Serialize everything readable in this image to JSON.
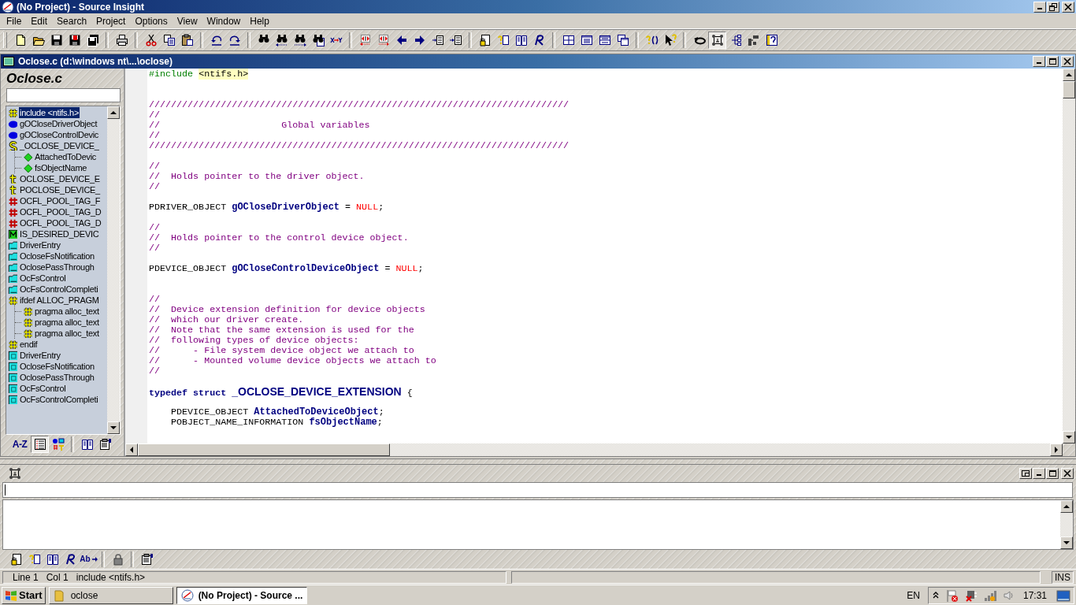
{
  "window": {
    "title": "(No Project) - Source Insight"
  },
  "menu": [
    "File",
    "Edit",
    "Search",
    "Project",
    "Options",
    "View",
    "Window",
    "Help"
  ],
  "toolbar": [
    [
      {
        "kind": "new",
        "pressed": false
      },
      {
        "kind": "open",
        "pressed": false
      },
      {
        "kind": "save",
        "pressed": false
      },
      {
        "kind": "saveas",
        "pressed": false
      },
      {
        "kind": "saveall",
        "pressed": false
      }
    ],
    [
      {
        "kind": "print",
        "pressed": false
      }
    ],
    [
      {
        "kind": "cut",
        "pressed": false
      },
      {
        "kind": "copy",
        "pressed": false
      },
      {
        "kind": "paste",
        "pressed": false
      }
    ],
    [
      {
        "kind": "undo",
        "pressed": false
      },
      {
        "kind": "redo",
        "pressed": false
      }
    ],
    [
      {
        "kind": "find",
        "pressed": false
      },
      {
        "kind": "findprev",
        "pressed": false
      },
      {
        "kind": "findnext",
        "pressed": false
      },
      {
        "kind": "findfiles",
        "pressed": false
      },
      {
        "kind": "replace",
        "pressed": false
      }
    ],
    [
      {
        "kind": "jumpback",
        "pressed": false
      },
      {
        "kind": "jumpfwd",
        "pressed": false
      },
      {
        "kind": "back",
        "pressed": false
      },
      {
        "kind": "forward",
        "pressed": false
      },
      {
        "kind": "outdent",
        "pressed": false
      },
      {
        "kind": "indent",
        "pressed": false
      }
    ],
    [
      {
        "kind": "lookup",
        "pressed": false
      },
      {
        "kind": "symbolinfo",
        "pressed": false
      },
      {
        "kind": "book",
        "pressed": false
      },
      {
        "kind": "reference",
        "pressed": false
      }
    ],
    [
      {
        "kind": "tile",
        "pressed": false
      },
      {
        "kind": "window",
        "pressed": false
      },
      {
        "kind": "split",
        "pressed": false
      },
      {
        "kind": "cascade",
        "pressed": false
      }
    ],
    [
      {
        "kind": "funcinfo",
        "pressed": false
      },
      {
        "kind": "pointerhelp",
        "pressed": false
      }
    ],
    [
      {
        "kind": "loop",
        "pressed": false
      },
      {
        "kind": "browse",
        "pressed": true
      },
      {
        "kind": "tree",
        "pressed": false
      },
      {
        "kind": "relation",
        "pressed": false
      },
      {
        "kind": "help",
        "pressed": false
      }
    ]
  ],
  "document": {
    "title": "Oclose.c (d:\\windows nt\\...\\oclose)",
    "symbol_panel": {
      "title": "Oclose.c",
      "items": [
        {
          "kind": "include",
          "label": "include <ntifs.h>",
          "selected": true
        },
        {
          "kind": "variable",
          "label": "gOCloseDriverObject",
          "selected": false
        },
        {
          "kind": "variable",
          "label": "gOCloseControlDevic",
          "selected": false
        },
        {
          "kind": "struct",
          "label": "_OCLOSE_DEVICE_",
          "selected": false,
          "children": [
            {
              "kind": "member",
              "label": "AttachedToDevic",
              "selected": false
            },
            {
              "kind": "member",
              "label": "fsObjectName",
              "selected": false
            }
          ]
        },
        {
          "kind": "typedef",
          "label": "OCLOSE_DEVICE_E",
          "selected": false
        },
        {
          "kind": "typedef",
          "label": "POCLOSE_DEVICE_",
          "selected": false
        },
        {
          "kind": "define",
          "label": "OCFL_POOL_TAG_F",
          "selected": false
        },
        {
          "kind": "define",
          "label": "OCFL_POOL_TAG_D",
          "selected": false
        },
        {
          "kind": "define",
          "label": "OCFL_POOL_TAG_D",
          "selected": false
        },
        {
          "kind": "macro",
          "label": "IS_DESIRED_DEVIC",
          "selected": false
        },
        {
          "kind": "prototype",
          "label": "DriverEntry",
          "selected": false
        },
        {
          "kind": "prototype",
          "label": "OcloseFsNotification",
          "selected": false
        },
        {
          "kind": "prototype",
          "label": "OclosePassThrough",
          "selected": false
        },
        {
          "kind": "prototype",
          "label": "OcFsControl",
          "selected": false
        },
        {
          "kind": "prototype",
          "label": "OcFsControlCompleti",
          "selected": false
        },
        {
          "kind": "include",
          "label": "ifdef ALLOC_PRAGM",
          "selected": false,
          "children": [
            {
              "kind": "include",
              "label": "pragma alloc_text",
              "selected": false
            },
            {
              "kind": "include",
              "label": "pragma alloc_text",
              "selected": false
            },
            {
              "kind": "include",
              "label": "pragma alloc_text",
              "selected": false
            }
          ]
        },
        {
          "kind": "include",
          "label": "endif",
          "selected": false
        },
        {
          "kind": "function",
          "label": "DriverEntry",
          "selected": false
        },
        {
          "kind": "function",
          "label": "OcloseFsNotification",
          "selected": false
        },
        {
          "kind": "function",
          "label": "OclosePassThrough",
          "selected": false
        },
        {
          "kind": "function",
          "label": "OcFsControl",
          "selected": false
        },
        {
          "kind": "function",
          "label": "OcFsControlCompleti",
          "selected": false
        }
      ],
      "toolbar": [
        {
          "kind": "sort",
          "label": "A-Z",
          "pressed": false
        },
        {
          "kind": "list",
          "pressed": true
        },
        {
          "kind": "categories",
          "pressed": false
        },
        {
          "kind": "book",
          "pressed": false
        },
        {
          "kind": "properties",
          "pressed": false
        }
      ]
    },
    "code": [
      {
        "kind": "code",
        "tokens": [
          {
            "kind": "preproc",
            "text": "#include "
          },
          {
            "kind": "header",
            "text": "<ntifs.h>"
          }
        ]
      },
      {
        "kind": "blank"
      },
      {
        "kind": "blank"
      },
      {
        "kind": "code",
        "tokens": [
          {
            "kind": "comment",
            "text": "////////////////////////////////////////////////////////////////////////////"
          }
        ]
      },
      {
        "kind": "code",
        "tokens": [
          {
            "kind": "comment",
            "text": "//"
          }
        ]
      },
      {
        "kind": "code",
        "tokens": [
          {
            "kind": "comment",
            "text": "//                      Global variables"
          }
        ]
      },
      {
        "kind": "code",
        "tokens": [
          {
            "kind": "comment",
            "text": "//"
          }
        ]
      },
      {
        "kind": "code",
        "tokens": [
          {
            "kind": "comment",
            "text": "////////////////////////////////////////////////////////////////////////////"
          }
        ]
      },
      {
        "kind": "blank"
      },
      {
        "kind": "code",
        "tokens": [
          {
            "kind": "comment",
            "text": "//"
          }
        ]
      },
      {
        "kind": "code",
        "tokens": [
          {
            "kind": "comment",
            "text": "//  Holds pointer to the driver object."
          }
        ]
      },
      {
        "kind": "code",
        "tokens": [
          {
            "kind": "comment",
            "text": "//"
          }
        ]
      },
      {
        "kind": "blank"
      },
      {
        "kind": "code",
        "tokens": [
          {
            "kind": "plain",
            "text": "PDRIVER_OBJECT "
          },
          {
            "kind": "decl",
            "text": "gOCloseDriverObject"
          },
          {
            "kind": "plain",
            "text": " = "
          },
          {
            "kind": "null",
            "text": "NULL"
          },
          {
            "kind": "plain",
            "text": ";"
          }
        ]
      },
      {
        "kind": "blank"
      },
      {
        "kind": "code",
        "tokens": [
          {
            "kind": "comment",
            "text": "//"
          }
        ]
      },
      {
        "kind": "code",
        "tokens": [
          {
            "kind": "comment",
            "text": "//  Holds pointer to the control device object."
          }
        ]
      },
      {
        "kind": "code",
        "tokens": [
          {
            "kind": "comment",
            "text": "//"
          }
        ]
      },
      {
        "kind": "blank"
      },
      {
        "kind": "code",
        "tokens": [
          {
            "kind": "plain",
            "text": "PDEVICE_OBJECT "
          },
          {
            "kind": "decl",
            "text": "gOCloseControlDeviceObject"
          },
          {
            "kind": "plain",
            "text": " = "
          },
          {
            "kind": "null",
            "text": "NULL"
          },
          {
            "kind": "plain",
            "text": ";"
          }
        ]
      },
      {
        "kind": "blank"
      },
      {
        "kind": "blank"
      },
      {
        "kind": "code",
        "tokens": [
          {
            "kind": "comment",
            "text": "//"
          }
        ]
      },
      {
        "kind": "code",
        "tokens": [
          {
            "kind": "comment",
            "text": "//  Device extension definition for device objects"
          }
        ]
      },
      {
        "kind": "code",
        "tokens": [
          {
            "kind": "comment",
            "text": "//  which our driver create."
          }
        ]
      },
      {
        "kind": "code",
        "tokens": [
          {
            "kind": "comment",
            "text": "//  Note that the same extension is used for the"
          }
        ]
      },
      {
        "kind": "code",
        "tokens": [
          {
            "kind": "comment",
            "text": "//  following types of device objects:"
          }
        ]
      },
      {
        "kind": "code",
        "tokens": [
          {
            "kind": "comment",
            "text": "//      - File system device object we attach to"
          }
        ]
      },
      {
        "kind": "code",
        "tokens": [
          {
            "kind": "comment",
            "text": "//      - Mounted volume device objects we attach to"
          }
        ]
      },
      {
        "kind": "code",
        "tokens": [
          {
            "kind": "comment",
            "text": "//"
          }
        ]
      },
      {
        "kind": "blank"
      },
      {
        "kind": "code",
        "tokens": [
          {
            "kind": "keyword",
            "text": "typedef struct "
          },
          {
            "kind": "typename",
            "text": "_OCLOSE_DEVICE_EXTENSION"
          },
          {
            "kind": "brace",
            "text": " {"
          }
        ]
      },
      {
        "kind": "blank"
      },
      {
        "kind": "code",
        "tokens": [
          {
            "kind": "plain",
            "text": "    PDEVICE_OBJECT "
          },
          {
            "kind": "decl",
            "text": "AttachedToDeviceObject"
          },
          {
            "kind": "plain",
            "text": ";"
          }
        ]
      },
      {
        "kind": "code",
        "tokens": [
          {
            "kind": "plain",
            "text": "    POBJECT_NAME_INFORMATION "
          },
          {
            "kind": "decl",
            "text": "fsObjectName"
          },
          {
            "kind": "plain",
            "text": ";"
          }
        ]
      }
    ]
  },
  "context_panel": {
    "toolbar": [
      {
        "kind": "lookup",
        "pressed": false
      },
      {
        "kind": "symbolinfo",
        "pressed": false
      },
      {
        "kind": "book",
        "pressed": false
      },
      {
        "kind": "reference",
        "pressed": false
      },
      {
        "kind": "abbrev",
        "label": "Ab",
        "pressed": false
      },
      {
        "kind": "lock",
        "pressed": false
      },
      {
        "kind": "properties",
        "pressed": false
      }
    ]
  },
  "status_bar": {
    "line": "Line 1",
    "column": "Col 1",
    "symbol": "include <ntifs.h>",
    "mode": "INS"
  },
  "taskbar": {
    "start": "Start",
    "tasks": [
      {
        "kind": "folder",
        "label": "oclose",
        "selected": false
      },
      {
        "kind": "app",
        "label": "(No Project) - Source ...",
        "selected": true
      }
    ],
    "language": "EN",
    "clock": "17:31"
  }
}
